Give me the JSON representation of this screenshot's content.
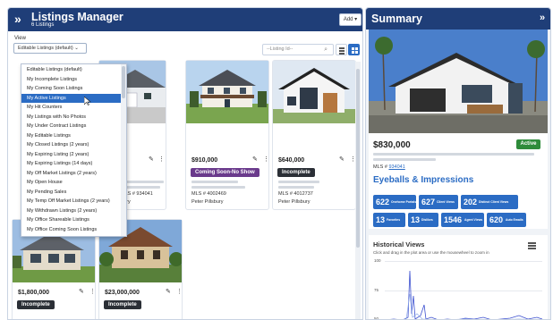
{
  "left_panel": {
    "title": "Listings Manager",
    "subtitle": "6 Listings",
    "add_label": "Add",
    "view_label": "View",
    "view_selected": "Editable Listings (default)",
    "listing_id_placeholder": "--Listing Id--"
  },
  "dropdown": {
    "options": [
      "Editable Listings (default)",
      "My Incomplete Listings",
      "My Coming Soon Listings",
      "My Active Listings",
      "My Hit Counters",
      "My Listings with No Photos",
      "My Under Contract Listings",
      "My Editable Listings",
      "My Closed Listings (2 years)",
      "My Expiring Listing (2 years)",
      "My Expiring Listings (14 days)",
      "My Off Market Listings (2 years)",
      "My Open House",
      "My Pending Sales",
      "My Temp Off Market Listings (2 years)",
      "My Withdrawn Listings (2 years)",
      "My Office Shareable Listings",
      "My Office Coming Soon Listings"
    ],
    "selected_index": 3
  },
  "cards": [
    {
      "price": "000",
      "status": "",
      "mls": "MLS # 934041",
      "agent": "bury"
    },
    {
      "price": "$910,000",
      "status": "Coming Soon-No Show",
      "mls": "MLS # 4002469",
      "agent": "Peter Pillsbury"
    },
    {
      "price": "$640,000",
      "status": "Incomplete",
      "mls": "MLS # 4012737",
      "agent": "Peter Pillsbury"
    },
    {
      "price": "$1,800,000",
      "status": "Incomplete"
    },
    {
      "price": "$23,000,000",
      "status": "Incomplete"
    }
  ],
  "summary": {
    "title": "Summary",
    "price": "$830,000",
    "status": "Active",
    "mls_prefix": "MLS #",
    "mls_link": "934041",
    "eyeballs_title": "Eyeballs & Impressions",
    "stats": [
      {
        "value": "622",
        "label": "Onehome Portals"
      },
      {
        "value": "627",
        "label": "Client Views"
      },
      {
        "value": "202",
        "label": "Distinct Client Views"
      },
      {
        "value": "13",
        "label": "Favorites"
      },
      {
        "value": "13",
        "label": "Dislikes"
      },
      {
        "value": "1546",
        "label": "Agent Views"
      },
      {
        "value": "620",
        "label": "Auto Emails"
      }
    ],
    "historical_title": "Historical Views",
    "historical_sub": "Click and drag in the plot area or use the mousewheel to zoom in",
    "y_ticks": [
      "100",
      "75",
      "50"
    ]
  },
  "colors": {
    "header": "#1f3e78",
    "accent": "#2b6cc4",
    "status_coming_soon": "#6a3a8c",
    "status_incomplete": "#2b2f36",
    "status_active": "#2e8b3a"
  },
  "icons": [
    "double-chevron-right-icon",
    "caret-down-icon",
    "search-icon",
    "list-view-icon",
    "grid-view-icon",
    "pencil-icon",
    "kebab-icon",
    "hamburger-menu-icon",
    "mouse-pointer-icon"
  ]
}
